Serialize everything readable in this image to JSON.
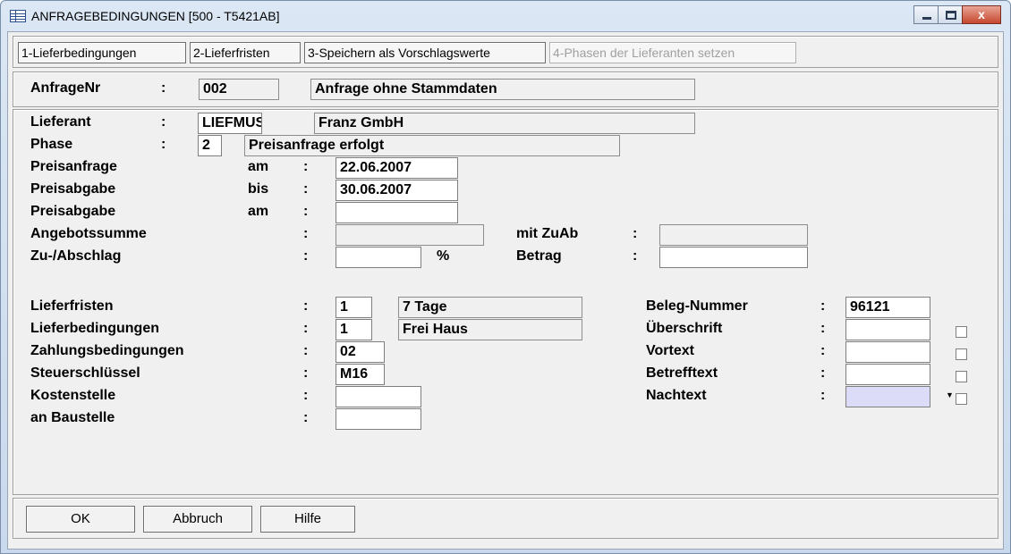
{
  "window": {
    "title": "ANFRAGEBEDINGUNGEN  [500 - T5421AB]",
    "close_symbol": "x"
  },
  "toolbar": {
    "btn1": "1-Lieferbedingungen",
    "btn2": "2-Lieferfristen",
    "btn3": "3-Speichern als Vorschlagswerte",
    "btn4": "4-Phasen der Lieferanten setzen"
  },
  "anfrage": {
    "label": "AnfrageNr",
    "colon": ":",
    "nr": "002",
    "text": "Anfrage ohne Stammdaten"
  },
  "form": {
    "lieferant_label": "Lieferant",
    "lieferant_code": "LIEFMUS",
    "lieferant_name": "Franz GmbH",
    "phase_label": "Phase",
    "phase_value": "2",
    "phase_text": "Preisanfrage erfolgt",
    "preisanfrage_label": "Preisanfrage",
    "preisanfrage_qual": "am",
    "preisanfrage_value": "22.06.2007",
    "preisabgabe_bis_label": "Preisabgabe",
    "preisabgabe_bis_qual": "bis",
    "preisabgabe_bis_value": "30.06.2007",
    "preisabgabe_am_label": "Preisabgabe",
    "preisabgabe_am_qual": "am",
    "preisabgabe_am_value": "",
    "angebotssumme_label": "Angebotssumme",
    "angebotssumme_value": "",
    "mit_zuab_label": "mit ZuAb",
    "mit_zuab_value": "",
    "zuabschlag_label": "Zu-/Abschlag",
    "zuabschlag_value": "",
    "percent": "%",
    "betrag_label": "Betrag",
    "betrag_value": "",
    "lieferfristen_label": "Lieferfristen",
    "lieferfristen_code": "1",
    "lieferfristen_text": "7 Tage",
    "lieferbedingungen_label": "Lieferbedingungen",
    "lieferbedingungen_code": "1",
    "lieferbedingungen_text": "Frei Haus",
    "zahlungsbedingungen_label": "Zahlungsbedingungen",
    "zahlungsbedingungen_value": "02",
    "steuerschluessel_label": "Steuerschlüssel",
    "steuerschluessel_value": "M16",
    "kostenstelle_label": "Kostenstelle",
    "kostenstelle_value": "",
    "baustelle_label": "an Baustelle",
    "baustelle_value": "",
    "beleg_label": "Beleg-Nummer",
    "beleg_value": "96121",
    "ueberschrift_label": "Überschrift",
    "ueberschrift_value": "",
    "vortext_label": "Vortext",
    "vortext_value": "",
    "betrefftext_label": "Betrefftext",
    "betrefftext_value": "",
    "nachtext_label": "Nachtext",
    "nachtext_value": ""
  },
  "footer": {
    "ok": "OK",
    "abbruch": "Abbruch",
    "hilfe": "Hilfe"
  }
}
